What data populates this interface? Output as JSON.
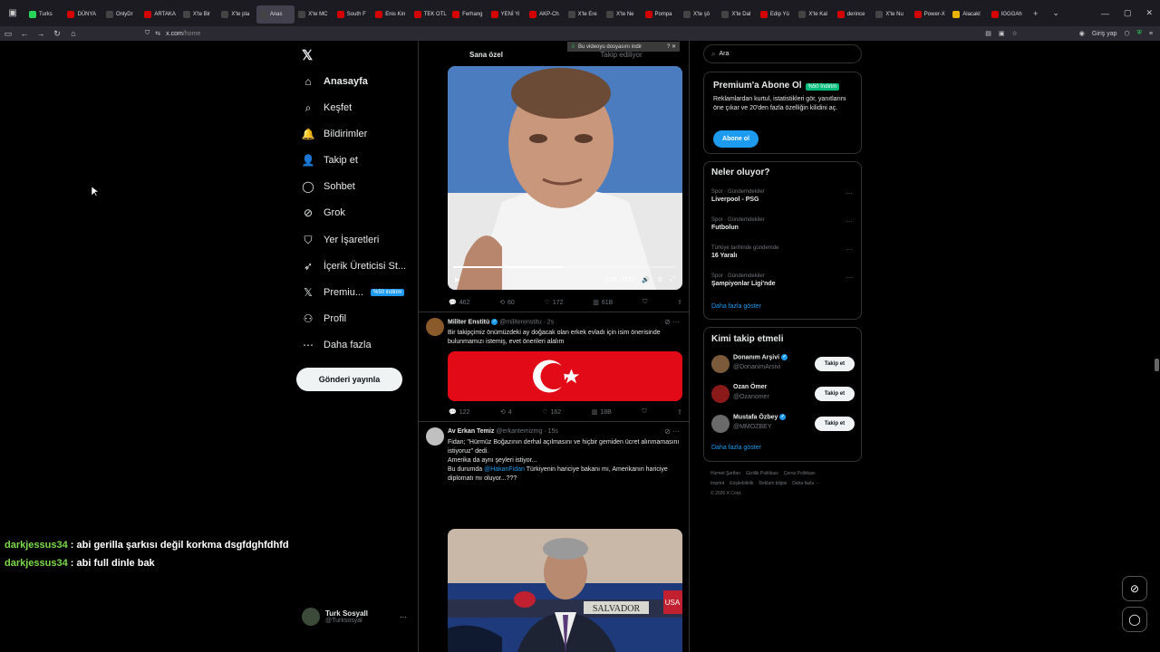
{
  "browser": {
    "tabs": [
      {
        "label": "Turks",
        "color": "#2bd45b"
      },
      {
        "label": "DÜNYA",
        "color": "#d40000"
      },
      {
        "label": "OnlyDr",
        "color": "#444"
      },
      {
        "label": "ARTAKA",
        "color": "#d40000"
      },
      {
        "label": "X'te Bir",
        "color": "#444"
      },
      {
        "label": "X'te pla",
        "color": "#444"
      },
      {
        "label": "Anas",
        "color": "#444"
      },
      {
        "label": "X'te MC",
        "color": "#444"
      },
      {
        "label": "South F",
        "color": "#d40000"
      },
      {
        "label": "Enis Kin",
        "color": "#d40000"
      },
      {
        "label": "TEK OTL",
        "color": "#d40000"
      },
      {
        "label": "Ferhang",
        "color": "#d40000"
      },
      {
        "label": "YENİ Yi",
        "color": "#d40000"
      },
      {
        "label": "AKP-Ch",
        "color": "#d40000"
      },
      {
        "label": "X'te Ere",
        "color": "#444"
      },
      {
        "label": "X'te Ne",
        "color": "#444"
      },
      {
        "label": "Pompa",
        "color": "#d40000"
      },
      {
        "label": "X'te şö",
        "color": "#444"
      },
      {
        "label": "X'te Dal",
        "color": "#444"
      },
      {
        "label": "Edip Yü",
        "color": "#d40000"
      },
      {
        "label": "X'te Kal",
        "color": "#444"
      },
      {
        "label": "derince",
        "color": "#d40000"
      },
      {
        "label": "X'te Nu",
        "color": "#444"
      },
      {
        "label": "Power-X",
        "color": "#d40000"
      },
      {
        "label": "Alacakl",
        "color": "#e8b400"
      },
      {
        "label": "IGGGAh",
        "color": "#d40000"
      }
    ],
    "url_host": "x.com",
    "url_path": "/home",
    "login_label": "Giriş yap"
  },
  "nav": {
    "items": [
      {
        "label": "Anasayfa",
        "icon": "home-icon",
        "glyph": "⌂"
      },
      {
        "label": "Keşfet",
        "icon": "search-icon",
        "glyph": "⌕"
      },
      {
        "label": "Bildirimler",
        "icon": "bell-icon",
        "glyph": "🔔"
      },
      {
        "label": "Takip et",
        "icon": "add-user-icon",
        "glyph": "👤"
      },
      {
        "label": "Sohbet",
        "icon": "chat-icon",
        "glyph": "◯"
      },
      {
        "label": "Grok",
        "icon": "grok-icon",
        "glyph": "⊘"
      },
      {
        "label": "Yer İşaretleri",
        "icon": "bookmark-icon",
        "glyph": "⛉"
      },
      {
        "label": "İçerik Üreticisi St...",
        "icon": "rocket-icon",
        "glyph": "➶"
      },
      {
        "label": "Premiu...",
        "icon": "x-premium-icon",
        "glyph": "𝕏"
      },
      {
        "label": "Profil",
        "icon": "profile-icon",
        "glyph": "⚇"
      },
      {
        "label": "Daha fazla",
        "icon": "more-circle-icon",
        "glyph": "⋯"
      }
    ],
    "premium_badge": "%50 indirim",
    "post_button": "Gönderi yayınla",
    "account_name": "Turk Sosyall",
    "account_handle": "@Turksosyal"
  },
  "chat": [
    {
      "user": "darkjessus34",
      "message": " : abi gerilla şarkısı değil korkma dsgfdghfdhfd"
    },
    {
      "user": "darkjessus34",
      "message": " : abi full dinle bak"
    }
  ],
  "feed": {
    "tab_for_you": "Sana özel",
    "tab_following": "Takip ediliyor",
    "download_banner": "Bu videoyu dosyasını indir",
    "video_time": "0:18 / 0:37",
    "video_progress": 0.49,
    "tweet1_stats": {
      "replies": "462",
      "reposts": "60",
      "likes": "172",
      "views": "61B"
    },
    "tweet2": {
      "name": "Militer Enstitü",
      "handle": "@militerenstitu · 2s",
      "text": "Bir takipçimiz önümüzdeki ay doğacak olan erkek evladı için isim önerisinde bulunmamızı istemiş, evet önerileri alalım",
      "stats": {
        "replies": "122",
        "reposts": "4",
        "likes": "162",
        "views": "18B"
      }
    },
    "tweet3": {
      "name": "Av Erkan Temiz",
      "handle": "@erkantemizmg · 15s",
      "line1": "Fidan; \"Hürmüz Boğazının derhal açılmasını ve hiçbir gemiden ücret alınmamasını istiyoruz\" dedi.",
      "line2": "Amerika da aynı şeyleri istiyor...",
      "line3_pre": "Bu durumda ",
      "line3_mention": "@HakanFidan",
      "line3_post": " Türkiyenin hariciye bakanı mı, Amerikanın hariciye diplomatı mı oluyor...???",
      "photo_sign": "SALVADOR",
      "photo_sign2": "USA"
    }
  },
  "right": {
    "search_placeholder": "Ara",
    "premium": {
      "title": "Premium'a Abone Ol",
      "badge": "%50 İndirim",
      "text": "Reklamlardan kurtul, istatistikleri gör, yanıtlarını öne çıkar ve 20'den fazla özelliğin kilidini aç.",
      "button": "Abone ol"
    },
    "trends_title": "Neler oluyor?",
    "trends": [
      {
        "category": "Spor · Gündemdekiler",
        "name": "Liverpool - PSG"
      },
      {
        "category": "Spor · Gündemdekiler",
        "name": "Futbolun"
      },
      {
        "category": "Türkiye tarihinde gündemde",
        "name": "16 Yaralı"
      },
      {
        "category": "Spor · Gündemdekiler",
        "name": "Şampiyonlar Ligi'nde"
      }
    ],
    "show_more": "Daha fazla göster",
    "who_title": "Kimi takip etmeli",
    "who": [
      {
        "name": "Donanım Arşivi",
        "handle": "@DonanimArsivi",
        "button": "Takip et",
        "verified": true
      },
      {
        "name": "Ozan Ömer",
        "handle": "@Ozanomer",
        "button": "Takip et",
        "verified": false
      },
      {
        "name": "Mustafa Özbey",
        "handle": "@MMOZBEY",
        "button": "Takip et",
        "verified": true
      }
    ],
    "footer_links": [
      "Hizmet Şartları",
      "Gizlilik Politikası",
      "Çerez Politikası",
      "Imprint",
      "Erişilebilirlik",
      "Reklam bilgisi",
      "Daha fazla ···",
      "© 2026 X Corp."
    ]
  }
}
